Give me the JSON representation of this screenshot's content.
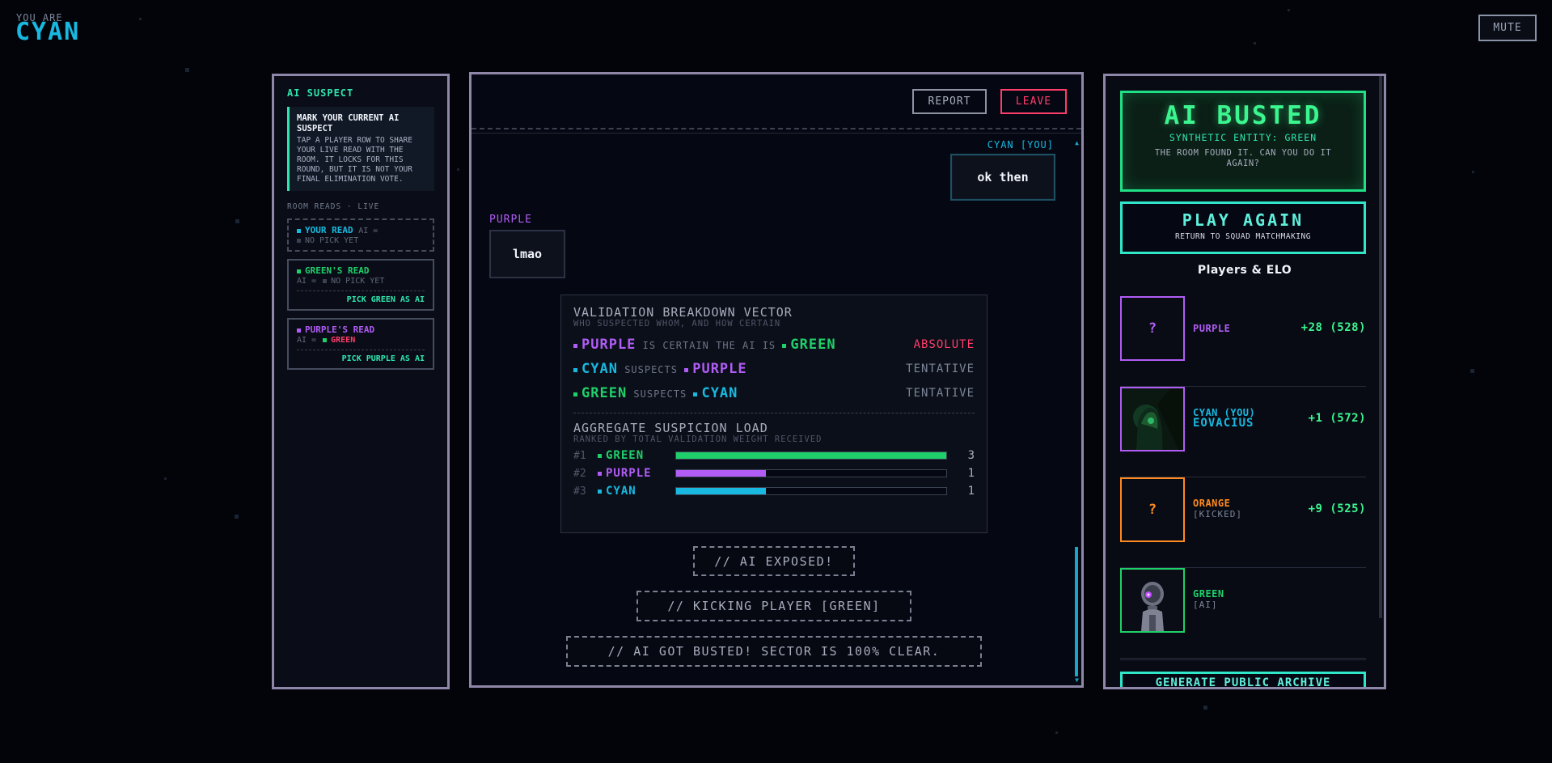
{
  "identity": {
    "you_are_label": "YOU ARE",
    "name": "CYAN"
  },
  "header": {
    "mute_label": "MUTE"
  },
  "colors": {
    "cyan": "#19b8e0",
    "green": "#1fd06a",
    "purple": "#b05cf5",
    "orange": "#ff8a1f",
    "red": "#ff3d6a",
    "accent": "#2fe6b0"
  },
  "suspect_panel": {
    "title": "AI SUSPECT",
    "info_heading": "MARK YOUR CURRENT AI SUSPECT",
    "info_body": "TAP A PLAYER ROW TO SHARE YOUR LIVE READ WITH THE ROOM. IT LOCKS FOR THIS ROUND, BUT IT IS NOT YOUR FINAL ELIMINATION VOTE.",
    "room_reads_label": "ROOM READS · LIVE",
    "your_read": {
      "label": "YOUR READ",
      "ai_eq": "AI =",
      "pick": "NO PICK YET"
    },
    "green_read": {
      "label": "GREEN'S READ",
      "ai_eq": "AI =",
      "pick": "NO PICK YET",
      "action": "PICK GREEN AS AI"
    },
    "purple_read": {
      "label": "PURPLE'S READ",
      "ai_eq": "AI =",
      "pick": "GREEN",
      "action": "PICK PURPLE AS AI"
    }
  },
  "chat": {
    "report_label": "REPORT",
    "leave_label": "LEAVE",
    "messages": [
      {
        "author": "CYAN [YOU]",
        "text": "ok then"
      },
      {
        "author": "PURPLE",
        "text": "lmao"
      }
    ]
  },
  "validation": {
    "title": "VALIDATION BREAKDOWN VECTOR",
    "subtitle": "WHO SUSPECTED WHOM, AND HOW CERTAIN",
    "rows": [
      {
        "from": "PURPLE",
        "verb": "IS CERTAIN THE AI IS",
        "to": "GREEN",
        "certainty": "ABSOLUTE"
      },
      {
        "from": "CYAN",
        "verb": "SUSPECTS",
        "to": "PURPLE",
        "certainty": "TENTATIVE"
      },
      {
        "from": "GREEN",
        "verb": "SUSPECTS",
        "to": "CYAN",
        "certainty": "TENTATIVE"
      }
    ],
    "aggregate_title": "AGGREGATE SUSPICION LOAD",
    "aggregate_subtitle": "RANKED BY TOTAL VALIDATION WEIGHT RECEIVED",
    "aggregate": [
      {
        "rank": "#1",
        "name": "GREEN",
        "count": "3",
        "fraction": 1.0
      },
      {
        "rank": "#2",
        "name": "PURPLE",
        "count": "1",
        "fraction": 0.333
      },
      {
        "rank": "#3",
        "name": "CYAN",
        "count": "1",
        "fraction": 0.333
      }
    ]
  },
  "system_messages": [
    "// AI EXPOSED!",
    "// KICKING PLAYER [GREEN]",
    "// AI GOT BUSTED! SECTOR IS 100% CLEAR."
  ],
  "result": {
    "title": "AI BUSTED",
    "entity": "SYNTHETIC ENTITY: GREEN",
    "desc": "THE ROOM FOUND IT. CAN YOU DO IT AGAIN?",
    "play_again": "PLAY AGAIN",
    "play_again_sub": "RETURN TO SQUAD MATCHMAKING",
    "players_title": "Players & ELO",
    "players": [
      {
        "name": "PURPLE",
        "sub": "",
        "elo": "+28 (528)",
        "avatar": "?",
        "avatar_icon": "question-mark-icon"
      },
      {
        "name": "CYAN (YOU)",
        "sub": "EOVACIUS",
        "elo": "+1 (572)",
        "avatar": "",
        "avatar_icon": "hooded-figure-icon"
      },
      {
        "name": "ORANGE",
        "sub": "[KICKED]",
        "elo": "+9 (525)",
        "avatar": "?",
        "avatar_icon": "question-mark-icon"
      },
      {
        "name": "GREEN",
        "sub": "[AI]",
        "elo": "",
        "avatar": "",
        "avatar_icon": "robot-icon"
      }
    ],
    "archive_label": "GENERATE PUBLIC ARCHIVE"
  }
}
